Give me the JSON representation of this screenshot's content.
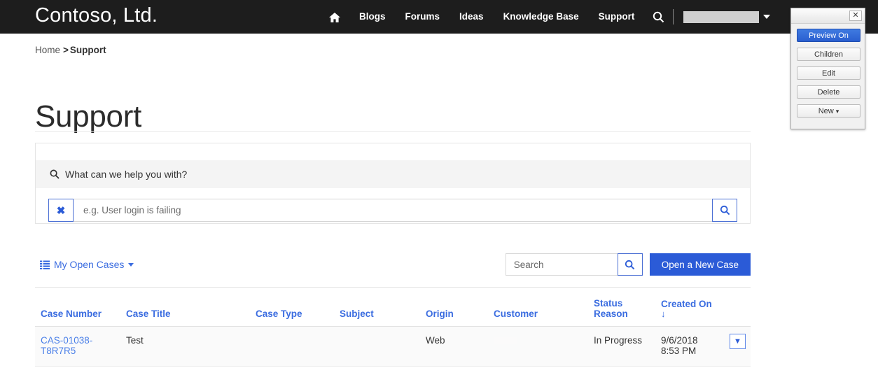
{
  "topnav": {
    "brand": "Contoso, Ltd.",
    "home_icon": "home-icon",
    "links": [
      "Blogs",
      "Forums",
      "Ideas",
      "Knowledge Base",
      "Support"
    ],
    "search_icon": "search-icon",
    "user_label": "",
    "user_caret": "chevron-down-icon",
    "background": "#1d1d1d"
  },
  "breadcrumb": {
    "home": "Home",
    "separator": ">",
    "current": "Support"
  },
  "page": {
    "title": "Support"
  },
  "kb_search": {
    "prompt": "What can we help you with?",
    "prompt_icon": "search-icon",
    "clear_icon": "clear-x-icon",
    "input_value": "",
    "input_placeholder": "e.g. User login is failing",
    "submit_icon": "search-icon"
  },
  "toolbar": {
    "view_icon": "list-view-icon",
    "view_label": "My Open Cases",
    "view_caret": "chevron-down-icon",
    "search_value": "",
    "search_placeholder": "Search",
    "search_icon": "search-icon",
    "new_case_label": "Open a New Case",
    "new_case_color": "#2b5bd7"
  },
  "table": {
    "columns": [
      {
        "label": "Case Number",
        "sorted": false
      },
      {
        "label": "Case Title",
        "sorted": false
      },
      {
        "label": "Case Type",
        "sorted": false
      },
      {
        "label": "Subject",
        "sorted": false
      },
      {
        "label": "Origin",
        "sorted": false
      },
      {
        "label": "Customer",
        "sorted": false
      },
      {
        "label": "Status Reason",
        "sorted": false
      },
      {
        "label": "Created On",
        "sorted": true,
        "sort_arrow": "↓"
      }
    ],
    "rows": [
      {
        "case_number": "CAS-01038-T8R7R5",
        "case_title": "Test",
        "case_type": "",
        "subject": "",
        "origin": "Web",
        "customer": "",
        "status_reason": "In Progress",
        "created_on": "9/6/2018 8:53 PM",
        "menu_icon": "chevron-down-icon"
      }
    ]
  },
  "editor_popup": {
    "close_icon": "close-x-icon",
    "buttons": [
      {
        "label": "Preview On",
        "active": true
      },
      {
        "label": "Children",
        "active": false
      },
      {
        "label": "Edit",
        "active": false
      },
      {
        "label": "Delete",
        "active": false
      },
      {
        "label": "New",
        "active": false,
        "caret": "▾"
      }
    ],
    "active_color": "#2a5fd0"
  }
}
